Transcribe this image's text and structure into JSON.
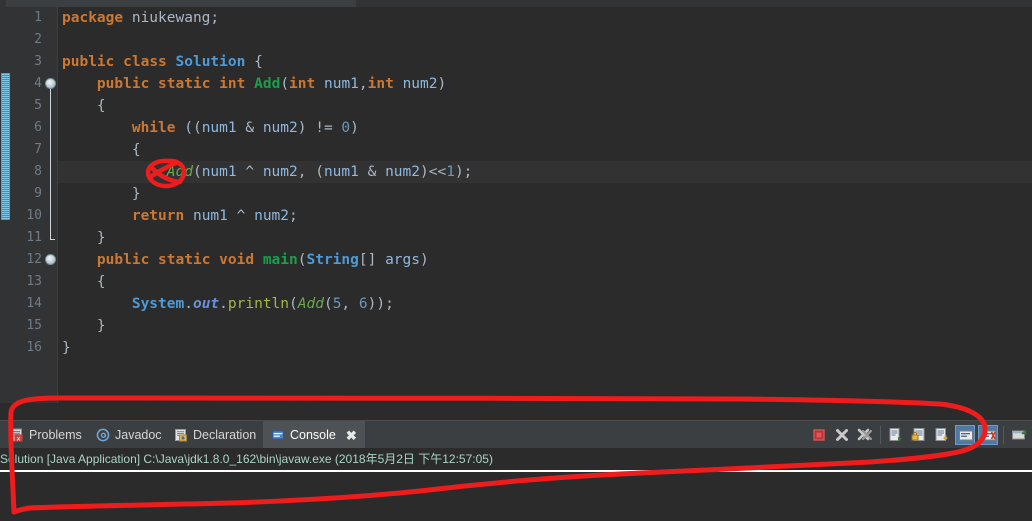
{
  "window": {
    "theme": "dark",
    "colors": {
      "editor_bg": "#2b2b2b",
      "gutter_bg": "#313335",
      "panel_bg": "#3c3f41",
      "active_tab_bg": "#4e5254",
      "current_line_bg": "#323232",
      "keyword": "#cc7832",
      "class_name": "#4e9ad6",
      "method_decl": "#1a9e4b",
      "method_call": "#a2b84a",
      "variable": "#8fb8e0",
      "number": "#6897bb",
      "static_field": "#6a8fd6",
      "console_text": "#a9d6c6",
      "annotation_red": "#ee1c1c",
      "overview_marker": "#7fc6e8"
    }
  },
  "editor": {
    "language": "java",
    "current_line": 8,
    "folding_markers": [
      4,
      12
    ],
    "lines": [
      {
        "number": 1,
        "tokens": [
          {
            "t": "package",
            "c": "kw"
          },
          {
            "t": " niukewang;",
            "c": "pl"
          }
        ]
      },
      {
        "number": 2,
        "tokens": []
      },
      {
        "number": 3,
        "tokens": [
          {
            "t": "public",
            "c": "kw"
          },
          {
            "t": " ",
            "c": "pl"
          },
          {
            "t": "class",
            "c": "kw"
          },
          {
            "t": " ",
            "c": "pl"
          },
          {
            "t": "Solution",
            "c": "cls"
          },
          {
            "t": " {",
            "c": "pl"
          }
        ]
      },
      {
        "number": 4,
        "tokens": [
          {
            "t": "    ",
            "c": "pl"
          },
          {
            "t": "public",
            "c": "kw"
          },
          {
            "t": " ",
            "c": "pl"
          },
          {
            "t": "static",
            "c": "kw"
          },
          {
            "t": " ",
            "c": "pl"
          },
          {
            "t": "int",
            "c": "kw"
          },
          {
            "t": " ",
            "c": "pl"
          },
          {
            "t": "Add",
            "c": "mth"
          },
          {
            "t": "(",
            "c": "pl"
          },
          {
            "t": "int",
            "c": "kw"
          },
          {
            "t": " ",
            "c": "pl"
          },
          {
            "t": "num1",
            "c": "var"
          },
          {
            "t": ",",
            "c": "pl"
          },
          {
            "t": "int",
            "c": "kw"
          },
          {
            "t": " ",
            "c": "pl"
          },
          {
            "t": "num2",
            "c": "var"
          },
          {
            "t": ")",
            "c": "pl"
          }
        ]
      },
      {
        "number": 5,
        "tokens": [
          {
            "t": "    {",
            "c": "pl"
          }
        ]
      },
      {
        "number": 6,
        "tokens": [
          {
            "t": "        ",
            "c": "pl"
          },
          {
            "t": "while",
            "c": "kw"
          },
          {
            "t": " ((",
            "c": "pl"
          },
          {
            "t": "num1",
            "c": "var"
          },
          {
            "t": " & ",
            "c": "pl"
          },
          {
            "t": "num2",
            "c": "var"
          },
          {
            "t": ") != ",
            "c": "pl"
          },
          {
            "t": "0",
            "c": "num"
          },
          {
            "t": ")",
            "c": "pl"
          }
        ]
      },
      {
        "number": 7,
        "tokens": [
          {
            "t": "        {",
            "c": "pl"
          }
        ]
      },
      {
        "number": 8,
        "tokens": [
          {
            "t": "            ",
            "c": "pl"
          },
          {
            "t": "Add",
            "c": "mthi"
          },
          {
            "t": "(",
            "c": "pl"
          },
          {
            "t": "num1",
            "c": "var"
          },
          {
            "t": " ^ ",
            "c": "pl"
          },
          {
            "t": "num2",
            "c": "var"
          },
          {
            "t": ", (",
            "c": "pl"
          },
          {
            "t": "num1",
            "c": "var"
          },
          {
            "t": " & ",
            "c": "pl"
          },
          {
            "t": "num2",
            "c": "var"
          },
          {
            "t": ")<<",
            "c": "pl"
          },
          {
            "t": "1",
            "c": "num"
          },
          {
            "t": ");",
            "c": "pl"
          }
        ]
      },
      {
        "number": 9,
        "tokens": [
          {
            "t": "        }",
            "c": "pl"
          }
        ]
      },
      {
        "number": 10,
        "tokens": [
          {
            "t": "        ",
            "c": "pl"
          },
          {
            "t": "return",
            "c": "kw"
          },
          {
            "t": " ",
            "c": "pl"
          },
          {
            "t": "num1",
            "c": "var"
          },
          {
            "t": " ^ ",
            "c": "pl"
          },
          {
            "t": "num2",
            "c": "var"
          },
          {
            "t": ";",
            "c": "pl"
          }
        ]
      },
      {
        "number": 11,
        "tokens": [
          {
            "t": "    }",
            "c": "pl"
          }
        ]
      },
      {
        "number": 12,
        "tokens": [
          {
            "t": "    ",
            "c": "pl"
          },
          {
            "t": "public",
            "c": "kw"
          },
          {
            "t": " ",
            "c": "pl"
          },
          {
            "t": "static",
            "c": "kw"
          },
          {
            "t": " ",
            "c": "pl"
          },
          {
            "t": "void",
            "c": "kw"
          },
          {
            "t": " ",
            "c": "pl"
          },
          {
            "t": "main",
            "c": "mth"
          },
          {
            "t": "(",
            "c": "pl"
          },
          {
            "t": "String",
            "c": "cls"
          },
          {
            "t": "[] ",
            "c": "pl"
          },
          {
            "t": "args",
            "c": "var"
          },
          {
            "t": ")",
            "c": "pl"
          }
        ]
      },
      {
        "number": 13,
        "tokens": [
          {
            "t": "    {",
            "c": "pl"
          }
        ]
      },
      {
        "number": 14,
        "tokens": [
          {
            "t": "        ",
            "c": "pl"
          },
          {
            "t": "System",
            "c": "cls"
          },
          {
            "t": ".",
            "c": "pl"
          },
          {
            "t": "out",
            "c": "fld"
          },
          {
            "t": ".",
            "c": "pl"
          },
          {
            "t": "println",
            "c": "mcall"
          },
          {
            "t": "(",
            "c": "pl"
          },
          {
            "t": "Add",
            "c": "mthi"
          },
          {
            "t": "(",
            "c": "pl"
          },
          {
            "t": "5",
            "c": "num"
          },
          {
            "t": ", ",
            "c": "pl"
          },
          {
            "t": "6",
            "c": "num"
          },
          {
            "t": "));",
            "c": "pl"
          }
        ]
      },
      {
        "number": 15,
        "tokens": [
          {
            "t": "    }",
            "c": "pl"
          }
        ]
      },
      {
        "number": 16,
        "tokens": [
          {
            "t": "}",
            "c": "pl"
          }
        ]
      }
    ]
  },
  "bottom_panel": {
    "tabs": [
      {
        "label": "Problems",
        "icon": "problems-icon",
        "active": false,
        "closable": false
      },
      {
        "label": "Javadoc",
        "icon": "javadoc-icon",
        "active": false,
        "closable": false
      },
      {
        "label": "Declaration",
        "icon": "declaration-icon",
        "active": false,
        "closable": false
      },
      {
        "label": "Console",
        "icon": "console-icon",
        "active": true,
        "closable": true
      }
    ],
    "toolbar": [
      {
        "name": "terminate-button",
        "icon": "stop-square-icon",
        "selected": false
      },
      {
        "name": "remove-launch-button",
        "icon": "x-icon",
        "selected": false
      },
      {
        "name": "remove-all-terminated-button",
        "icon": "xx-icon",
        "selected": false
      },
      {
        "name": "display-selected-console-button",
        "icon": "console-page-icon",
        "selected": false
      },
      {
        "name": "pin-console-button",
        "icon": "console-lock-icon",
        "selected": false
      },
      {
        "name": "open-console-button",
        "icon": "console-arrow-icon",
        "selected": false
      },
      {
        "name": "scroll-lock-button",
        "icon": "scroll-lock-icon",
        "selected": true
      },
      {
        "name": "word-wrap-button",
        "icon": "word-wrap-icon",
        "selected": true
      },
      {
        "name": "view-menu-button",
        "icon": "view-menu-icon",
        "selected": false
      }
    ],
    "console": {
      "launch_line": "Solution [Java Application] C:\\Java\\jdk1.8.0_162\\bin\\javaw.exe (2018年5月2日 下午12:57:05)",
      "output": ""
    }
  },
  "annotations": [
    {
      "name": "circle-on-line-8",
      "shape": "scribbled-oval",
      "color": "#ee1c1c"
    },
    {
      "name": "big-loop-around-console-panel",
      "shape": "scribbled-loop",
      "color": "#ee1c1c"
    }
  ]
}
